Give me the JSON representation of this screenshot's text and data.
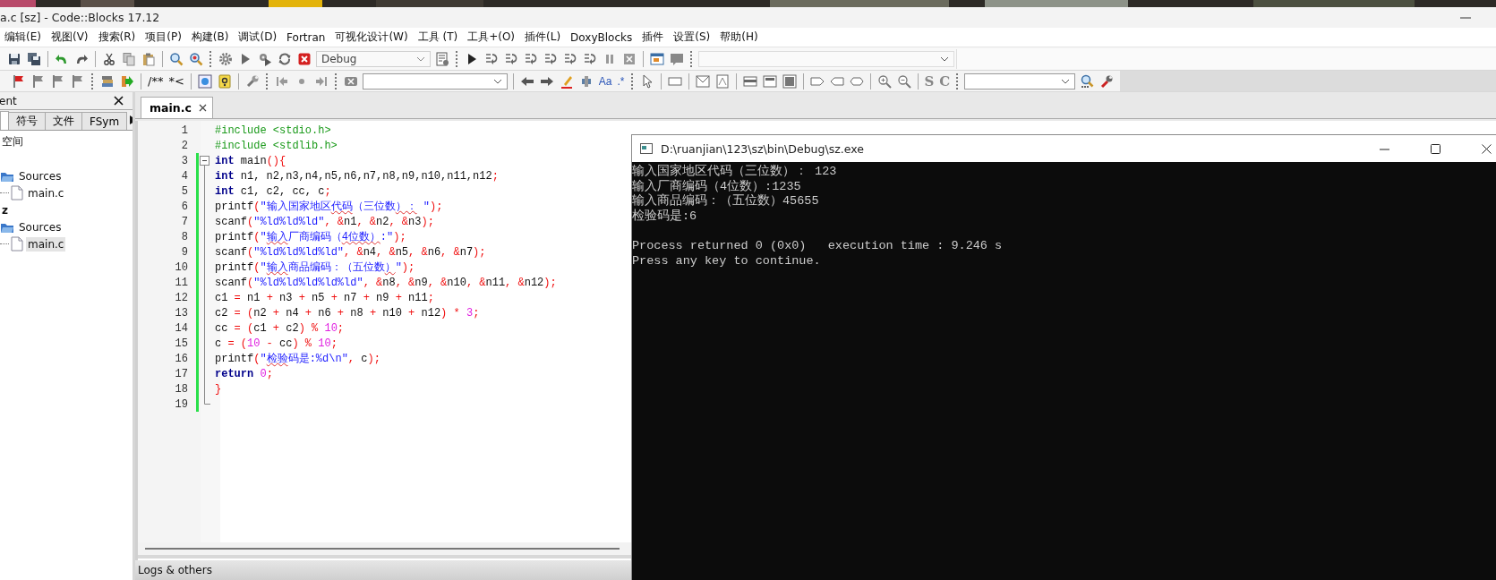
{
  "window": {
    "title": "a.c [sz] - Code::Blocks 17.12"
  },
  "menu": [
    "编辑(E)",
    "视图(V)",
    "搜索(R)",
    "项目(P)",
    "构建(B)",
    "调试(D)",
    "Fortran",
    "可视化设计(W)",
    "工具 (T)",
    "工具+(O)",
    "插件(L)",
    "DoxyBlocks",
    "插件",
    "设置(S)",
    "帮助(H)"
  ],
  "toolbar_1": {
    "build_target": "Debug"
  },
  "toolbar_2": {
    "doc_comment": "/**",
    "line_comment": "*<",
    "match_case": "Aa",
    "regex": ".*",
    "s_button": "S",
    "c_button": "C"
  },
  "management_panel": {
    "title": "ent",
    "tabs": [
      {
        "selected": true
      },
      {
        "label": "符号",
        "selected": false
      },
      {
        "label": "文件",
        "selected": false
      },
      {
        "label": "FSym",
        "selected": false
      }
    ],
    "tree": [
      {
        "label": "空间",
        "children": [
          {
            "children": [
              {
                "label": "Sources",
                "children": [
                  {
                    "label": "main.c",
                    "selected": false
                  }
                ]
              }
            ]
          },
          {
            "label": "z",
            "active": true,
            "children": [
              {
                "label": "Sources",
                "children": [
                  {
                    "label": "main.c",
                    "selected": true
                  }
                ]
              }
            ]
          }
        ]
      }
    ]
  },
  "editor": {
    "tabs": [
      {
        "label": "main.c",
        "selected": true
      }
    ],
    "lines": [
      {
        "number": "1",
        "changed": false,
        "tokens": [
          {
            "kind": "pp",
            "text": "#include <stdio.h>"
          }
        ]
      },
      {
        "number": "2",
        "changed": false,
        "tokens": [
          {
            "kind": "pp",
            "text": "#include <stdlib.h>"
          }
        ]
      },
      {
        "number": "3",
        "changed": true,
        "fold": {
          "kind": "start"
        },
        "tokens": [
          {
            "kind": "kw",
            "text": "int"
          },
          {
            "kind": "id",
            "text": " main"
          },
          {
            "kind": "op",
            "text": "(){"
          }
        ]
      },
      {
        "number": "4",
        "changed": true,
        "fold": {
          "kind": "body"
        },
        "tokens": [
          {
            "kind": "kw",
            "text": "int"
          },
          {
            "kind": "id",
            "text": " n1, n2,n3,n4,n5,n6,n7,n8,n9,n10,n11,n12"
          },
          {
            "kind": "op",
            "text": ";"
          }
        ]
      },
      {
        "number": "5",
        "changed": true,
        "fold": {
          "kind": "body"
        },
        "tokens": [
          {
            "kind": "kw",
            "text": "int"
          },
          {
            "kind": "id",
            "text": " c1, c2, cc, c"
          },
          {
            "kind": "op",
            "text": ";"
          }
        ]
      },
      {
        "number": "6",
        "changed": true,
        "fold": {
          "kind": "body"
        },
        "tokens": [
          {
            "kind": "id",
            "text": "printf"
          },
          {
            "kind": "op",
            "text": "("
          },
          {
            "kind": "str",
            "text": "\"输入国家地区"
          },
          {
            "kind": "strx",
            "text": "代码"
          },
          {
            "kind": "str",
            "text": "（三位数"
          },
          {
            "kind": "strx",
            "text": "）："
          },
          {
            "kind": "str",
            "text": " \""
          },
          {
            "kind": "op",
            "text": ");"
          }
        ]
      },
      {
        "number": "7",
        "changed": true,
        "fold": {
          "kind": "body"
        },
        "tokens": [
          {
            "kind": "id",
            "text": "scanf"
          },
          {
            "kind": "op",
            "text": "("
          },
          {
            "kind": "str",
            "text": "\"%ld%ld%ld\""
          },
          {
            "kind": "op",
            "text": ", &"
          },
          {
            "kind": "id",
            "text": "n1"
          },
          {
            "kind": "op",
            "text": ", &"
          },
          {
            "kind": "id",
            "text": "n2"
          },
          {
            "kind": "op",
            "text": ", &"
          },
          {
            "kind": "id",
            "text": "n3"
          },
          {
            "kind": "op",
            "text": ");"
          }
        ]
      },
      {
        "number": "8",
        "changed": true,
        "fold": {
          "kind": "body"
        },
        "tokens": [
          {
            "kind": "id",
            "text": "printf"
          },
          {
            "kind": "op",
            "text": "("
          },
          {
            "kind": "str",
            "text": "\""
          },
          {
            "kind": "strx",
            "text": "输入"
          },
          {
            "kind": "str",
            "text": "厂商编码（"
          },
          {
            "kind": "strx",
            "text": "4位数）"
          },
          {
            "kind": "str",
            "text": ":\""
          },
          {
            "kind": "op",
            "text": ");"
          }
        ]
      },
      {
        "number": "9",
        "changed": true,
        "fold": {
          "kind": "body"
        },
        "tokens": [
          {
            "kind": "id",
            "text": "scanf"
          },
          {
            "kind": "op",
            "text": "("
          },
          {
            "kind": "str",
            "text": "\"%ld%ld%ld%ld\""
          },
          {
            "kind": "op",
            "text": ", &"
          },
          {
            "kind": "id",
            "text": "n4"
          },
          {
            "kind": "op",
            "text": ", &"
          },
          {
            "kind": "id",
            "text": "n5"
          },
          {
            "kind": "op",
            "text": ", &"
          },
          {
            "kind": "id",
            "text": "n6"
          },
          {
            "kind": "op",
            "text": ", &"
          },
          {
            "kind": "id",
            "text": "n7"
          },
          {
            "kind": "op",
            "text": ");"
          }
        ]
      },
      {
        "number": "10",
        "changed": true,
        "fold": {
          "kind": "body"
        },
        "tokens": [
          {
            "kind": "id",
            "text": "printf"
          },
          {
            "kind": "op",
            "text": "("
          },
          {
            "kind": "str",
            "text": "\""
          },
          {
            "kind": "strx",
            "text": "输入"
          },
          {
            "kind": "str",
            "text": "商品编码：（五位数"
          },
          {
            "kind": "strx",
            "text": "）"
          },
          {
            "kind": "str",
            "text": "\""
          },
          {
            "kind": "op",
            "text": ");"
          }
        ]
      },
      {
        "number": "11",
        "changed": true,
        "fold": {
          "kind": "body"
        },
        "tokens": [
          {
            "kind": "id",
            "text": "scanf"
          },
          {
            "kind": "op",
            "text": "("
          },
          {
            "kind": "str",
            "text": "\"%ld%ld%ld%ld%ld\""
          },
          {
            "kind": "op",
            "text": ", &"
          },
          {
            "kind": "id",
            "text": "n8"
          },
          {
            "kind": "op",
            "text": ", &"
          },
          {
            "kind": "id",
            "text": "n9"
          },
          {
            "kind": "op",
            "text": ", &"
          },
          {
            "kind": "id",
            "text": "n10"
          },
          {
            "kind": "op",
            "text": ", &"
          },
          {
            "kind": "id",
            "text": "n11"
          },
          {
            "kind": "op",
            "text": ", &"
          },
          {
            "kind": "id",
            "text": "n12"
          },
          {
            "kind": "op",
            "text": ");"
          }
        ]
      },
      {
        "number": "12",
        "changed": true,
        "fold": {
          "kind": "body"
        },
        "tokens": [
          {
            "kind": "id",
            "text": "c1 "
          },
          {
            "kind": "op",
            "text": "="
          },
          {
            "kind": "id",
            "text": " n1 "
          },
          {
            "kind": "op",
            "text": "+"
          },
          {
            "kind": "id",
            "text": " n3 "
          },
          {
            "kind": "op",
            "text": "+"
          },
          {
            "kind": "id",
            "text": " n5 "
          },
          {
            "kind": "op",
            "text": "+"
          },
          {
            "kind": "id",
            "text": " n7 "
          },
          {
            "kind": "op",
            "text": "+"
          },
          {
            "kind": "id",
            "text": " n9 "
          },
          {
            "kind": "op",
            "text": "+"
          },
          {
            "kind": "id",
            "text": " n11"
          },
          {
            "kind": "op",
            "text": ";"
          }
        ]
      },
      {
        "number": "13",
        "changed": true,
        "fold": {
          "kind": "body"
        },
        "tokens": [
          {
            "kind": "id",
            "text": "c2 "
          },
          {
            "kind": "op",
            "text": "= ("
          },
          {
            "kind": "id",
            "text": "n2 "
          },
          {
            "kind": "op",
            "text": "+"
          },
          {
            "kind": "id",
            "text": " n4 "
          },
          {
            "kind": "op",
            "text": "+"
          },
          {
            "kind": "id",
            "text": " n6 "
          },
          {
            "kind": "op",
            "text": "+"
          },
          {
            "kind": "id",
            "text": " n8 "
          },
          {
            "kind": "op",
            "text": "+"
          },
          {
            "kind": "id",
            "text": " n10 "
          },
          {
            "kind": "op",
            "text": "+"
          },
          {
            "kind": "id",
            "text": " n12"
          },
          {
            "kind": "op",
            "text": ") * "
          },
          {
            "kind": "num",
            "text": "3"
          },
          {
            "kind": "op",
            "text": ";"
          }
        ]
      },
      {
        "number": "14",
        "changed": true,
        "fold": {
          "kind": "body"
        },
        "tokens": [
          {
            "kind": "id",
            "text": "cc "
          },
          {
            "kind": "op",
            "text": "= ("
          },
          {
            "kind": "id",
            "text": "c1 "
          },
          {
            "kind": "op",
            "text": "+"
          },
          {
            "kind": "id",
            "text": " c2"
          },
          {
            "kind": "op",
            "text": ") % "
          },
          {
            "kind": "num",
            "text": "10"
          },
          {
            "kind": "op",
            "text": ";"
          }
        ]
      },
      {
        "number": "15",
        "changed": true,
        "fold": {
          "kind": "body"
        },
        "tokens": [
          {
            "kind": "id",
            "text": "c "
          },
          {
            "kind": "op",
            "text": "= ("
          },
          {
            "kind": "num",
            "text": "10"
          },
          {
            "kind": "op",
            "text": " - "
          },
          {
            "kind": "id",
            "text": "cc"
          },
          {
            "kind": "op",
            "text": ") % "
          },
          {
            "kind": "num",
            "text": "10"
          },
          {
            "kind": "op",
            "text": ";"
          }
        ]
      },
      {
        "number": "16",
        "changed": true,
        "fold": {
          "kind": "body"
        },
        "tokens": [
          {
            "kind": "id",
            "text": "printf"
          },
          {
            "kind": "op",
            "text": "("
          },
          {
            "kind": "str",
            "text": "\""
          },
          {
            "kind": "strx",
            "text": "检验"
          },
          {
            "kind": "str",
            "text": "码是:%d\\n\""
          },
          {
            "kind": "op",
            "text": ", "
          },
          {
            "kind": "id",
            "text": "c"
          },
          {
            "kind": "op",
            "text": ");"
          }
        ]
      },
      {
        "number": "17",
        "changed": true,
        "fold": {
          "kind": "body"
        },
        "tokens": [
          {
            "kind": "kw",
            "text": "return"
          },
          {
            "kind": "num",
            "text": " 0"
          },
          {
            "kind": "op",
            "text": ";"
          }
        ]
      },
      {
        "number": "18",
        "changed": true,
        "fold": {
          "kind": "body"
        },
        "tokens": [
          {
            "kind": "op",
            "text": "}"
          }
        ]
      },
      {
        "number": "19",
        "changed": true,
        "fold": {
          "kind": "end"
        }
      }
    ]
  },
  "bottom_panel": {
    "label": "Logs & others"
  },
  "console": {
    "title": "D:\\ruanjian\\123\\sz\\bin\\Debug\\sz.exe",
    "output": [
      "输入国家地区代码（三位数）： 123",
      "输入厂商编码（4位数）:1235",
      "输入商品编码：（五位数）45655",
      "检验码是:6"
    ],
    "status": [
      "Process returned 0 (0x0)   execution time : 9.246 s",
      "Press any key to continue."
    ]
  }
}
